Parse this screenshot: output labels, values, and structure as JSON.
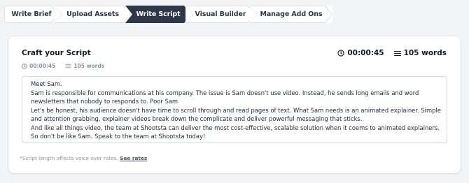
{
  "steps": [
    {
      "label": "Write Brief",
      "active": false
    },
    {
      "label": "Upload Assets",
      "active": false
    },
    {
      "label": "Write Script",
      "active": true
    },
    {
      "label": "Visual Builder",
      "active": false
    },
    {
      "label": "Manage Add Ons",
      "active": false
    }
  ],
  "card": {
    "title": "Craft your Script",
    "duration": "00:00:45",
    "word_count": "105 words",
    "duration_small": "00:00:45",
    "word_count_small": "105 words",
    "script_lines": [
      "Meet Sam.",
      "Sam is responsible for communications at his company. The issue is Sam doesn't use video. Instead, he sends long emails and word",
      "newsletters that nobody to responds to. Poor Sam",
      "Let's be honest, his audience doesn't have time to scroll through and read pages of text. What Sam needs is an animated explainer. Simple",
      "and attention grabbing, explainer videos break down the complicate and deliver powerful messaging that sticks.",
      "And like all things video, the team at Shootsta can deliver the most cost-effective, scalable solution when it coems to animated explainers.",
      "So don't be like Sam. Speak to the team at Shootsta today!"
    ],
    "footnote_text": "*Script length affects voice over rates.",
    "footnote_link": "See rates"
  },
  "icons": {
    "clock": "clock-icon",
    "lines": "text-lines-icon"
  },
  "colors": {
    "active_step": "#2d3748",
    "muted_text": "#8a94a3",
    "background": "#f3f4f6"
  }
}
